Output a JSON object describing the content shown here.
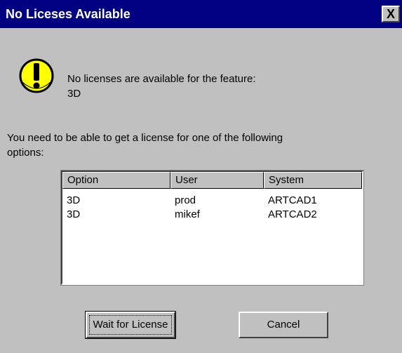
{
  "dialog": {
    "title": "No Liceses Available",
    "close_label": "X",
    "icon": "exclamation-icon",
    "message_line1": "No licenses are available for the feature:",
    "message_line2": "3D",
    "instructions_line1": "You need to be able to get a license for one of the following",
    "instructions_line2": "options:"
  },
  "licenses": {
    "columns": [
      "Option",
      "User",
      "System"
    ],
    "rows": [
      [
        "3D",
        "prod",
        "ARTCAD1"
      ],
      [
        "3D",
        "mikef",
        "ARTCAD2"
      ]
    ]
  },
  "buttons": {
    "wait": "Wait for License",
    "cancel": "Cancel"
  },
  "colors": {
    "titlebar": "#000080",
    "face": "#c0c0c0",
    "warning": "#ffff00"
  }
}
